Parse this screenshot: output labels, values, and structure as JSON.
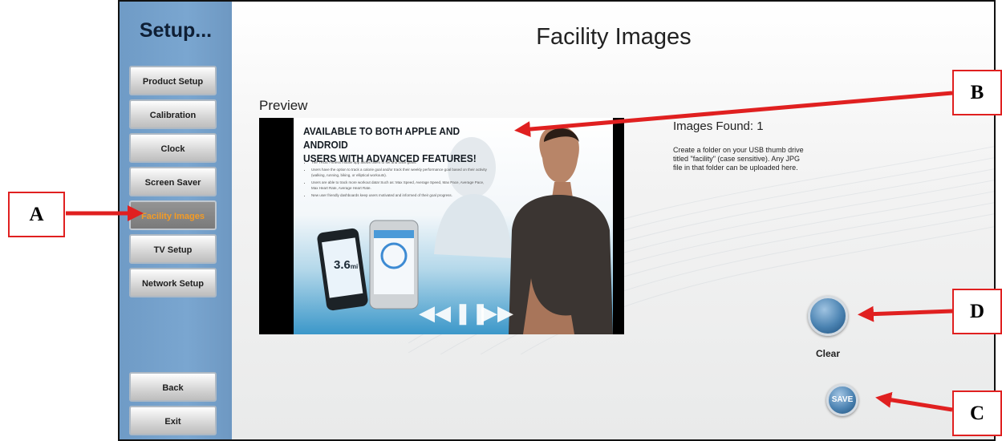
{
  "sidebar": {
    "title": "Setup...",
    "items": [
      {
        "label": "Product Setup"
      },
      {
        "label": "Calibration"
      },
      {
        "label": "Clock"
      },
      {
        "label": "Screen Saver"
      },
      {
        "label": "Facility Images",
        "active": true
      },
      {
        "label": "TV Setup"
      },
      {
        "label": "Network Setup"
      }
    ],
    "back_label": "Back",
    "exit_label": "Exit"
  },
  "main": {
    "title": "Facility Images",
    "preview_label": "Preview",
    "preview_image": {
      "headline_line1": "AVAILABLE TO BOTH APPLE AND ANDROID",
      "headline_line2": "USERS WITH ADVANCED FEATURES!",
      "bullets": [
        "The TRUE Fitness mobile app allows users to set and track goals.",
        "Users have the option to track a calorie goal and/or track their weekly performance goal based on their activity (walking, running, biking, or elliptical workouts).",
        "Users are able to track more workout data! Such as: Max Speed, Average Speed, Max Pace, Average Pace, Max Heart Rate, Average Heart Rate.",
        "New user friendly dashboards keep users motivated and informed of their goal progress."
      ],
      "phone_distance": "3.6",
      "phone_unit": "mi"
    },
    "images_found": "Images Found: 1",
    "instructions": "Create a folder on your USB thumb drive titled \"facility\" (case sensitive). Any JPG file in that folder can be uploaded here.",
    "clear_label": "Clear",
    "save_label": "SAVE"
  },
  "callouts": {
    "a": "A",
    "b": "B",
    "c": "C",
    "d": "D"
  },
  "colors": {
    "sidebar_blue": "#7aa6d0",
    "active_text": "#f49b25",
    "callout_red": "#e02020"
  },
  "icons": {
    "rewind": "rewind-icon",
    "pause": "pause-icon",
    "fast_forward": "fast-forward-icon"
  }
}
